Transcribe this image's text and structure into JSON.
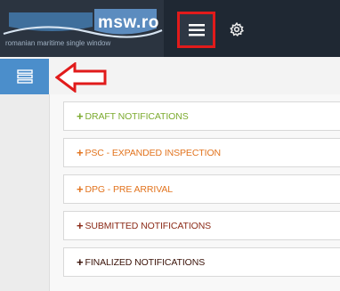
{
  "header": {
    "logo_text": "msw.ro",
    "logo_subtitle": "romanian maritime single window",
    "menu_icon": "hamburger-icon",
    "settings_icon": "gear-icon",
    "highlight_color": "#e11b1b"
  },
  "sidebar": {
    "toggle_icon": "list-icon",
    "toggle_color": "#4b8ecb",
    "annotation_icon": "red-arrow-icon"
  },
  "menu": [
    {
      "sign": "+",
      "label": "DRAFT NOTIFICATIONS",
      "color": "#7cab2f"
    },
    {
      "sign": "+",
      "label": "PSC - EXPANDED INSPECTION",
      "color": "#e2741f"
    },
    {
      "sign": "+",
      "label": "DPG - PRE ARRIVAL",
      "color": "#e2741f"
    },
    {
      "sign": "+",
      "label": "SUBMITTED NOTIFICATIONS",
      "color": "#8b2a17"
    },
    {
      "sign": "+",
      "label": "FINALIZED NOTIFICATIONS",
      "color": "#3a1208"
    }
  ]
}
